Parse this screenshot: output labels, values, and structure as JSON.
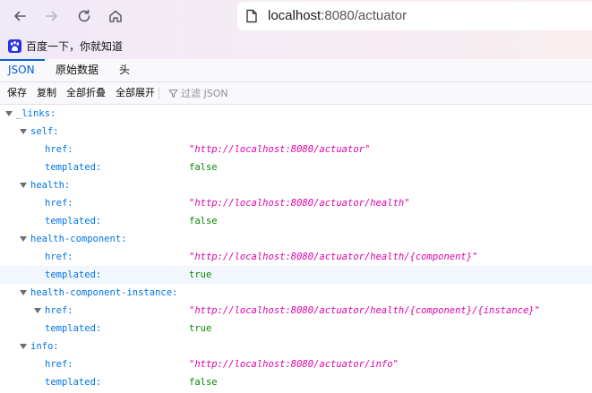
{
  "browser": {
    "url_host": "localhost",
    "url_rest": ":8080/actuator",
    "bookmark_label": "百度一下，你就知道"
  },
  "tabs": [
    {
      "label": "JSON"
    },
    {
      "label": "原始数据"
    },
    {
      "label": "头"
    }
  ],
  "toolbar": {
    "save": "保存",
    "copy": "复制",
    "collapse_all": "全部折叠",
    "expand_all": "全部展开",
    "filter_placeholder": "过滤 JSON"
  },
  "tree": {
    "root_key": "_links:",
    "href_key": "href:",
    "templated_key": "templated:",
    "self": {
      "key": "self:",
      "href": "\"http://localhost:8080/actuator\"",
      "templated": "false"
    },
    "health": {
      "key": "health:",
      "href": "\"http://localhost:8080/actuator/health\"",
      "templated": "false"
    },
    "health_component": {
      "key": "health-component:",
      "href": "\"http://localhost:8080/actuator/health/{component}\"",
      "templated": "true"
    },
    "health_component_instance": {
      "key": "health-component-instance:",
      "href": "\"http://localhost:8080/actuator/health/{component}/{instance}\"",
      "templated": "true"
    },
    "info": {
      "key": "info:",
      "href": "\"http://localhost:8080/actuator/info\"",
      "templated": "false"
    }
  },
  "colors": {
    "key": "#0074e8",
    "string": "#dd00a9",
    "boolean": "#058b00",
    "active_tab": "#0060df"
  }
}
